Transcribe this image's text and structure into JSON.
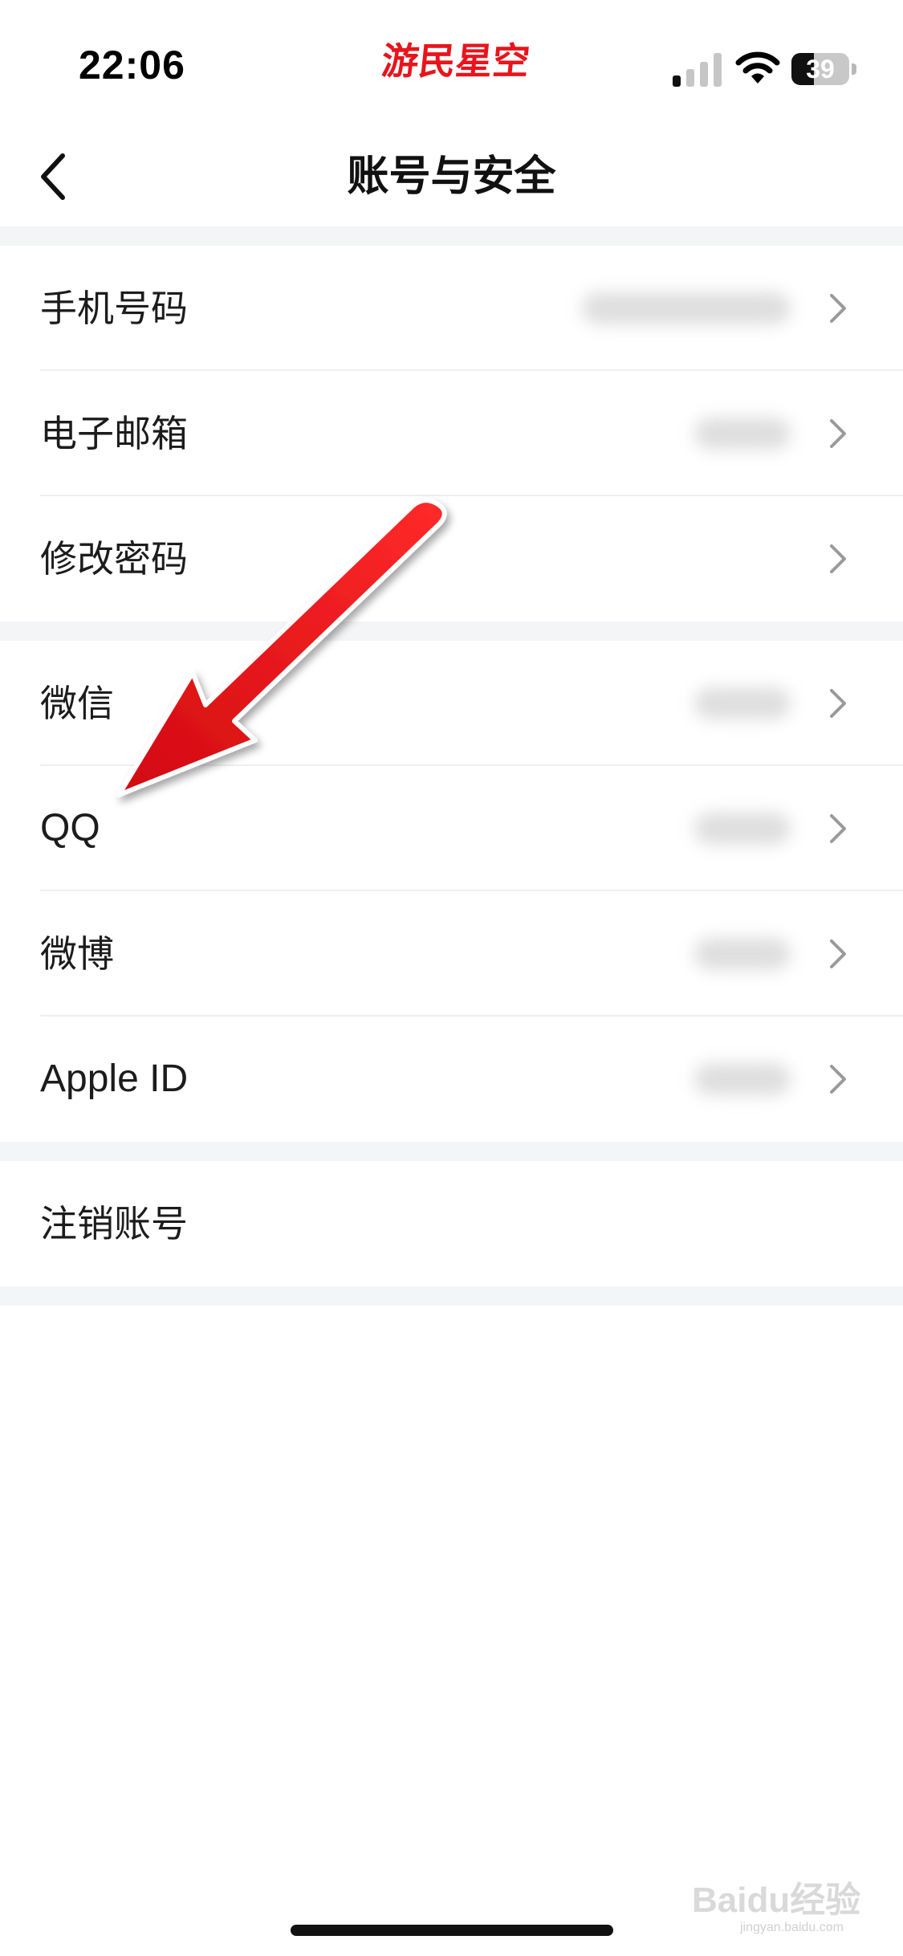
{
  "status_bar": {
    "time": "22:06",
    "watermark_logo": "游民星空",
    "battery_level": "39",
    "battery_fraction": 0.39,
    "icons": [
      "signal-icon",
      "wifi-icon",
      "battery-icon"
    ]
  },
  "nav": {
    "back_icon": "chevron-left-icon",
    "title": "账号与安全"
  },
  "groups": [
    {
      "items": [
        {
          "label": "手机号码",
          "value_hidden": true
        },
        {
          "label": "电子邮箱",
          "value_hidden": true
        },
        {
          "label": "修改密码",
          "value_hidden": false
        }
      ]
    },
    {
      "items": [
        {
          "label": "微信",
          "value_hidden": true
        },
        {
          "label": "QQ",
          "value_hidden": true
        },
        {
          "label": "微博",
          "value_hidden": true
        },
        {
          "label": "Apple ID",
          "value_hidden": true
        }
      ]
    },
    {
      "items": [
        {
          "label": "注销账号"
        }
      ]
    }
  ],
  "overlay": {
    "annotation_arrow_color": "#e8141c",
    "baidu_watermark": "Baidu经验",
    "baidu_url": "jingyan.baidu.com"
  },
  "colors": {
    "accent": "#e8141c",
    "page_background": "#ffffff",
    "group_gap": "#f4f5f7"
  }
}
